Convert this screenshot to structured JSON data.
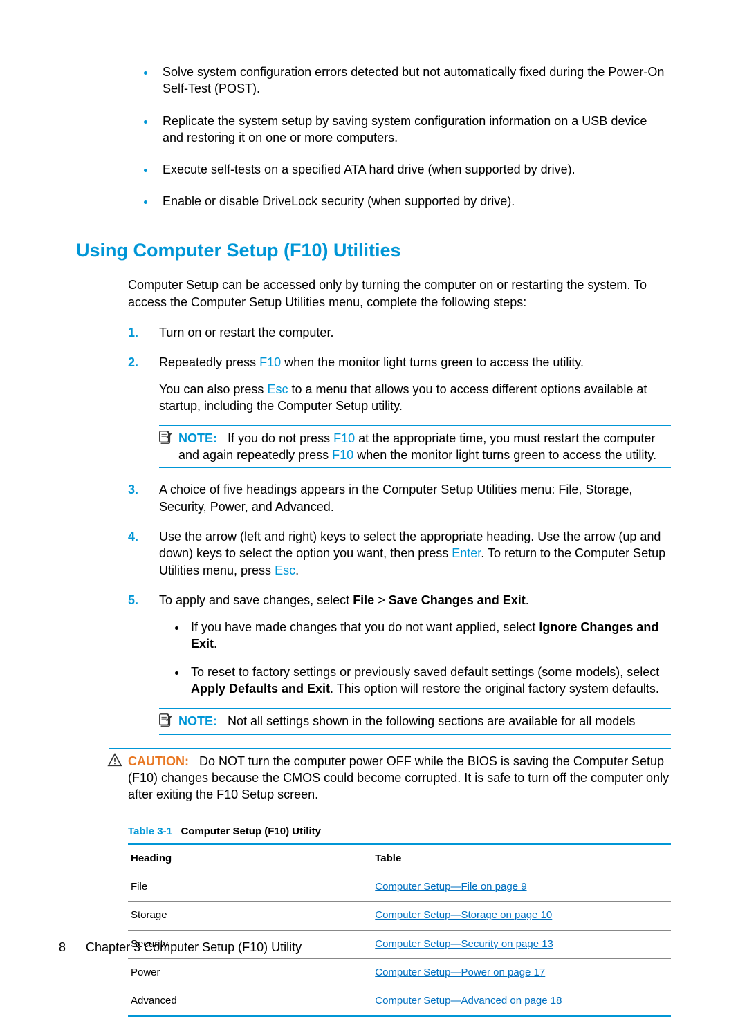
{
  "bullets": [
    "Solve system configuration errors detected but not automatically fixed during the Power-On Self-Test (POST).",
    "Replicate the system setup by saving system configuration information on a USB device and restoring it on one or more computers.",
    "Execute self-tests on a specified ATA hard drive (when supported by drive).",
    "Enable or disable DriveLock security (when supported by drive)."
  ],
  "heading": "Using Computer Setup (F10) Utilities",
  "intro": "Computer Setup can be accessed only by turning the computer on or restarting the system. To access the Computer Setup Utilities menu, complete the following steps:",
  "steps": {
    "s1": "Turn on or restart the computer.",
    "s2a": "Repeatedly press ",
    "s2key": "F10",
    "s2b": " when the monitor light turns green to access the utility.",
    "s2c": "You can also press ",
    "s2key2": "Esc",
    "s2d": " to a menu that allows you to access different options available at startup, including the Computer Setup utility.",
    "note1_label": "NOTE:",
    "note1a": "If you do not press ",
    "note1k1": "F10",
    "note1b": " at the appropriate time, you must restart the computer and again repeatedly press ",
    "note1k2": "F10",
    "note1c": " when the monitor light turns green to access the utility.",
    "s3": "A choice of five headings appears in the Computer Setup Utilities menu: File, Storage, Security, Power, and Advanced.",
    "s4a": "Use the arrow (left and right) keys to select the appropriate heading. Use the arrow (up and down) keys to select the option you want, then press ",
    "s4k1": "Enter",
    "s4b": ". To return to the Computer Setup Utilities menu, press ",
    "s4k2": "Esc",
    "s4c": ".",
    "s5a": "To apply and save changes, select ",
    "s5b1": "File",
    "s5gt": " > ",
    "s5b2": "Save Changes and Exit",
    "s5c": ".",
    "sub1a": "If you have made changes that you do not want applied, select ",
    "sub1b": "Ignore Changes and Exit",
    "sub1c": ".",
    "sub2a": "To reset to factory settings or previously saved default settings (some models), select ",
    "sub2b": "Apply Defaults and Exit",
    "sub2c": ". This option will restore the original factory system defaults.",
    "note2_label": "NOTE:",
    "note2": "Not all settings shown in the following sections are available for all models"
  },
  "caution": {
    "label": "CAUTION:",
    "text": "Do NOT turn the computer power OFF while the BIOS is saving the Computer Setup (F10) changes because the CMOS could become corrupted. It is safe to turn off the computer only after exiting the F10 Setup screen."
  },
  "table": {
    "caption_label": "Table 3-1",
    "caption_title": "Computer Setup (F10) Utility",
    "col1": "Heading",
    "col2": "Table",
    "rows": [
      {
        "h": "File",
        "link": "Computer Setup—File on page 9"
      },
      {
        "h": "Storage",
        "link": "Computer Setup—Storage on page 10"
      },
      {
        "h": "Security",
        "link": "Computer Setup—Security on page 13"
      },
      {
        "h": "Power",
        "link": "Computer Setup—Power on page 17"
      },
      {
        "h": "Advanced",
        "link": "Computer Setup—Advanced on page 18"
      }
    ]
  },
  "footer": {
    "page": "8",
    "chapter": "Chapter 3   Computer Setup (F10) Utility"
  }
}
